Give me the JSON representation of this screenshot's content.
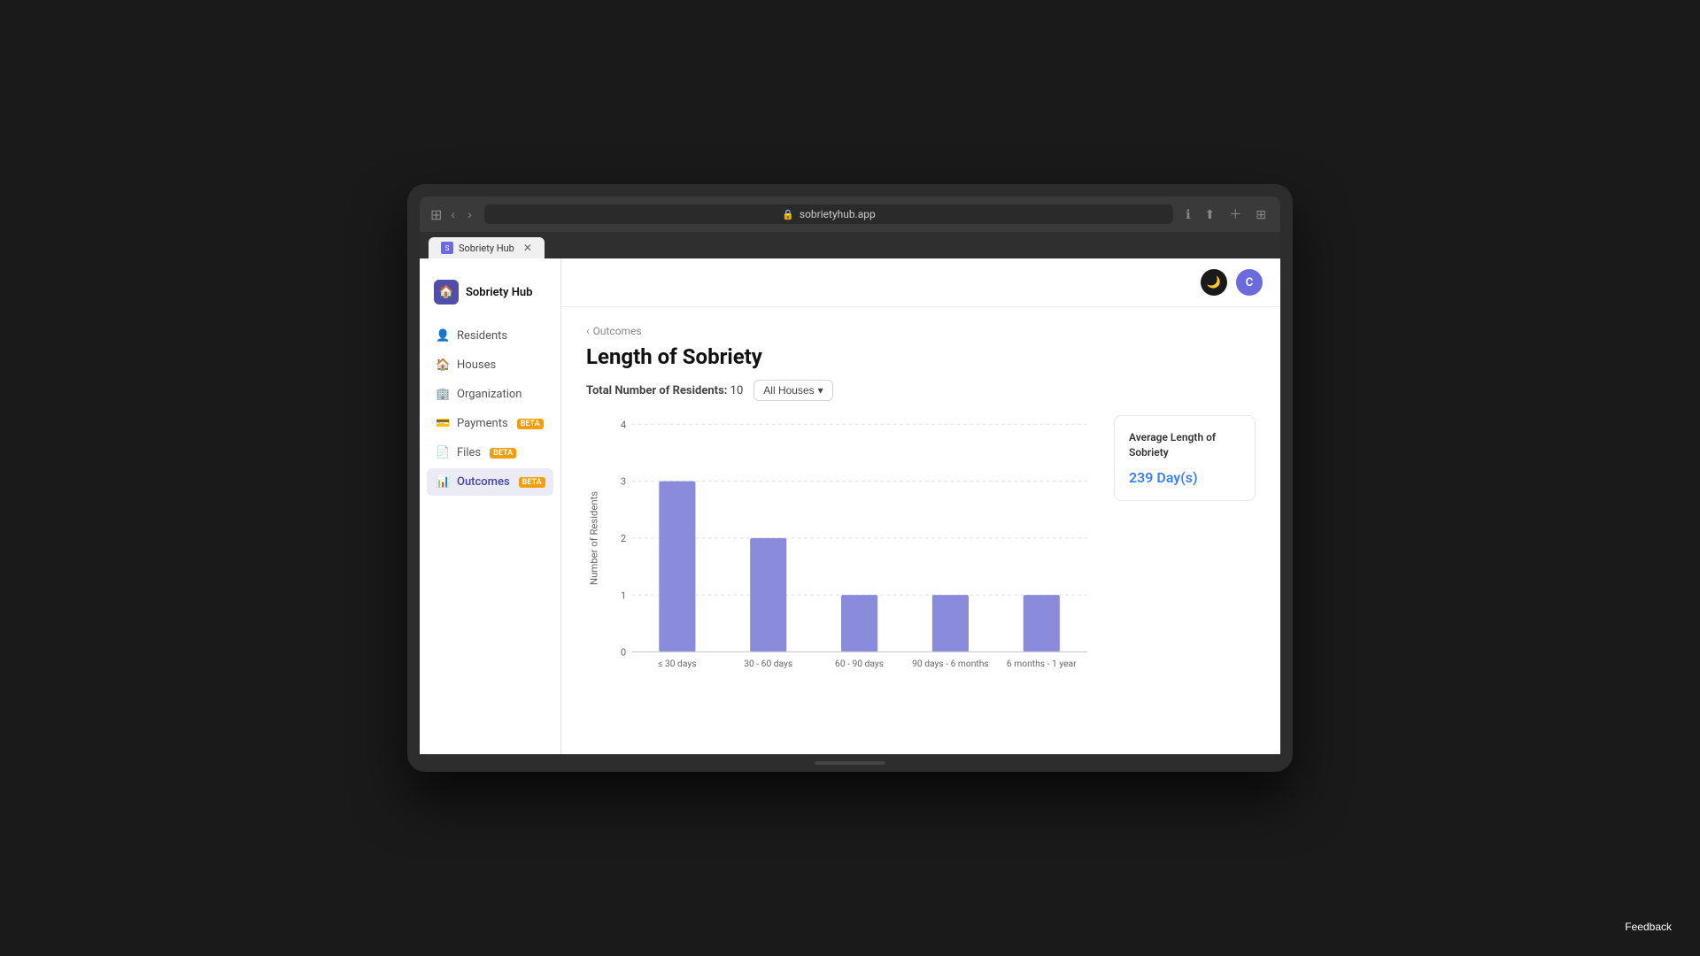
{
  "browser": {
    "url": "sobrietyhub.app",
    "tab_title": "Sobriety Hub",
    "back_btn": "‹",
    "forward_btn": "›"
  },
  "sidebar": {
    "logo_text": "Sobriety Hub",
    "items": [
      {
        "id": "residents",
        "label": "Residents",
        "icon": "👤",
        "beta": false,
        "active": false
      },
      {
        "id": "houses",
        "label": "Houses",
        "icon": "🏠",
        "beta": false,
        "active": false
      },
      {
        "id": "organization",
        "label": "Organization",
        "icon": "🏢",
        "beta": false,
        "active": false
      },
      {
        "id": "payments",
        "label": "Payments",
        "icon": "💳",
        "beta": true,
        "active": false
      },
      {
        "id": "files",
        "label": "Files",
        "icon": "📄",
        "beta": true,
        "active": false
      },
      {
        "id": "outcomes",
        "label": "Outcomes",
        "icon": "📊",
        "beta": true,
        "active": true
      }
    ]
  },
  "topbar": {
    "user_initial": "C"
  },
  "page": {
    "breadcrumb_icon": "‹",
    "breadcrumb_label": "Outcomes",
    "title": "Length of Sobriety",
    "total_label": "Total Number of Residents:",
    "total_value": "10",
    "filter_label": "All Houses",
    "filter_icon": "▾"
  },
  "chart": {
    "y_label": "Number of Residents",
    "x_label": "",
    "y_max": 4,
    "y_ticks": [
      0,
      1,
      2,
      3,
      4
    ],
    "bars": [
      {
        "label": "≤ 30 days",
        "value": 3
      },
      {
        "label": "30 - 60 days",
        "value": 2
      },
      {
        "label": "60 - 90 days",
        "value": 1
      },
      {
        "label": "90 days - 6 months",
        "value": 1
      },
      {
        "label": "6 months - 1 year",
        "value": 1
      }
    ],
    "bar_color": "#8b8bdb"
  },
  "legend": {
    "title": "Average Length of Sobriety",
    "value": "239 Day(s)",
    "value_color": "#3b82f6"
  },
  "feedback": {
    "label": "Feedback"
  }
}
